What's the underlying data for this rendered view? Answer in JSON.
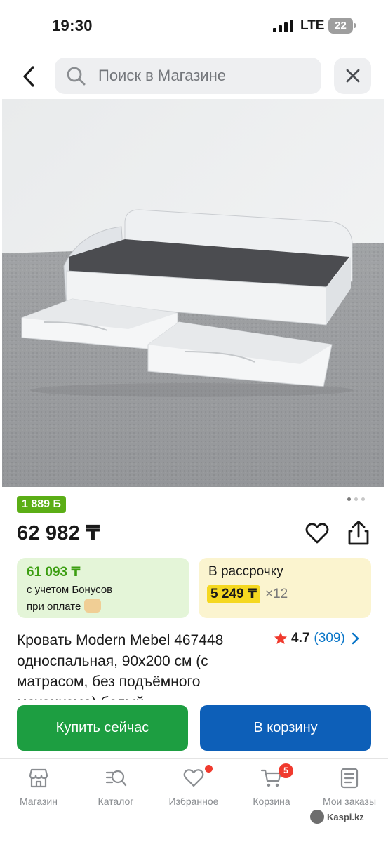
{
  "status_bar": {
    "time": "19:30",
    "network": "LTE",
    "battery": "22",
    "icons": [
      "signal-icon",
      "battery-icon"
    ]
  },
  "header": {
    "back_icon": "chevron-left-icon",
    "search_placeholder": "Поиск в Магазине",
    "search_icon": "search-icon",
    "close_icon": "close-icon"
  },
  "product": {
    "image_subject": "product-photo",
    "bonus_badge": "1 889 ",
    "price": "62 982 ₸",
    "title": "Кровать Modern Mebel 467448 односпальная, 90x200 см (с матрасом, без подъёмного механизма) белый",
    "rating": "4.7",
    "reviews": "(309)",
    "carousel": {
      "total": 3,
      "active": 0
    }
  },
  "offers": {
    "bonus_price": "61 093 ₸",
    "bonus_line1": "с учетом Бонусов",
    "bonus_line2": "при оплате",
    "installment_title": "В рассрочку",
    "installment_amount": "5 249 ₸",
    "installment_months": "×12"
  },
  "actions": {
    "buy_now": "Купить сейчас",
    "add_to_cart": "В корзину"
  },
  "bottom_nav": [
    {
      "label": "Магазин",
      "icon": "store-icon"
    },
    {
      "label": "Каталог",
      "icon": "catalog-search-icon"
    },
    {
      "label": "Избранное",
      "icon": "heart-icon"
    },
    {
      "label": "Корзина",
      "icon": "cart-icon",
      "badge": "5"
    },
    {
      "label": "Мои заказы",
      "icon": "orders-icon"
    }
  ],
  "watermark": "Kaspi.kz",
  "colors": {
    "bonus_green": "#5bae16",
    "buy_green": "#1d9e41",
    "cart_blue": "#0d5fb8",
    "installment_yellow": "#f5d820",
    "badge_red": "#f03a2e",
    "rating_blue": "#0a76c8"
  }
}
